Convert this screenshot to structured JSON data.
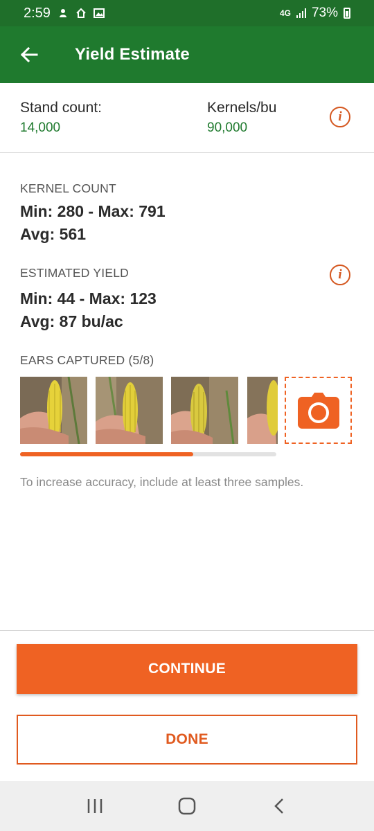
{
  "status_bar": {
    "time": "2:59",
    "network": "4G",
    "battery": "73%"
  },
  "app_bar": {
    "title": "Yield Estimate",
    "back_icon": "arrow-left-icon"
  },
  "summary": {
    "stand_count_label": "Stand count:",
    "stand_count_value": "14,000",
    "kernels_label": "Kernels/bu",
    "kernels_value": "90,000",
    "info_icon": "info-icon"
  },
  "kernel_count": {
    "label": "KERNEL COUNT",
    "range": "Min: 280 - Max: 791",
    "avg": "Avg: 561"
  },
  "estimated_yield": {
    "label": "ESTIMATED YIELD",
    "range": "Min: 44 - Max: 123",
    "avg": "Avg: 87 bu/ac"
  },
  "ears": {
    "label": "EARS CAPTURED (5/8)",
    "progress": 0.675,
    "camera_icon": "camera-icon"
  },
  "hint": "To increase accuracy, include at least three samples.",
  "actions": {
    "continue_label": "CONTINUE",
    "done_label": "DONE"
  },
  "colors": {
    "primary_green": "#1f7a2e",
    "accent_orange": "#ef6223"
  }
}
